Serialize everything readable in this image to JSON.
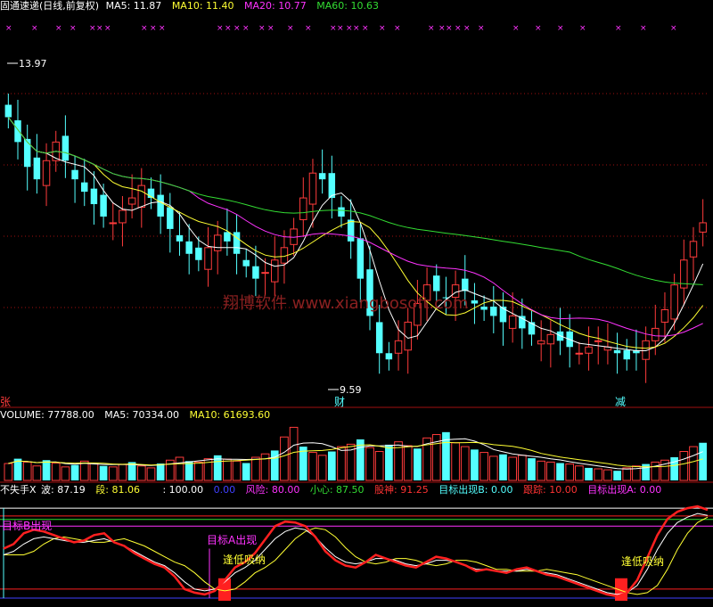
{
  "panels": {
    "price": {
      "title": "固通速递(日线,前复权)",
      "ma5_label": "MA5: 11.87",
      "ma10_label": "MA10: 11.40",
      "ma20_label": "MA20: 10.77",
      "ma60_label": "MA60: 10.63",
      "high_label": "13.97",
      "low_label": "9.59",
      "marker_cai": "财",
      "marker_jian": "减",
      "marker_zhang": "张",
      "watermark": "翔博软件 www.xiangbosoft.com"
    },
    "volume": {
      "title": "VOLUME: 77788.00",
      "ma5_label": "MA5: 70334.00",
      "ma10_label": "MA10: 61693.60"
    },
    "indicator": {
      "name": "不失手X",
      "bo": "波: 87.19",
      "duan": "段: 81.06",
      "v100": ": 100.00",
      "v0": "0.00",
      "fengxian": "风险: 80.00",
      "xiaoxin": "小心: 87.50",
      "gushen": "股神: 91.25",
      "mubiao_b": "目标出现B: 0.00",
      "genzong": "跟踪: 10.00",
      "mubiao_a": "目标出现A: 0.00",
      "ann_b": "目标B出现",
      "ann_a": "目标A出现",
      "ann_fengdi1": "逢低吸纳",
      "ann_fengdi2": "逢低吸纳"
    }
  },
  "colors": {
    "up": "#ff3b3b",
    "down": "#54ffff",
    "ma5": "#ffffff",
    "ma10": "#ffff33",
    "ma20": "#ff33ff",
    "ma60": "#33dd33",
    "grid": "#a01010",
    "ind_main": "#ff2020",
    "ind_fast": "#ffffff",
    "ind_slow": "#ffff33",
    "text_name": "#ffffff",
    "text_bo": "#ffffff",
    "text_duan": "#ffff33",
    "text_0": "#4040ff",
    "text_fx": "#ff33ff",
    "text_xx": "#33dd33",
    "text_gs": "#ff3333",
    "text_mb": "#54ffff",
    "text_gz": "#ff3333",
    "text_ma": "#ff33ff"
  },
  "chart_data": [
    {
      "type": "candlestick",
      "title": "固通速递(日线,前复权)",
      "ylim": [
        9.0,
        15.2
      ],
      "annotations": {
        "high": 13.97,
        "low": 9.59
      },
      "close_path": [
        13.6,
        13.2,
        12.8,
        12.6,
        12.9,
        13.2,
        12.9,
        12.6,
        12.4,
        12.2,
        12.0,
        11.9,
        12.1,
        12.3,
        12.5,
        12.3,
        12.0,
        11.8,
        11.6,
        11.4,
        11.3,
        11.5,
        11.7,
        11.6,
        11.4,
        11.2,
        11.0,
        11.1,
        11.3,
        11.5,
        11.8,
        12.3,
        12.7,
        12.6,
        12.3,
        12.0,
        11.6,
        11.0,
        10.4,
        9.8,
        9.7,
        10.0,
        10.3,
        10.6,
        10.9,
        10.8,
        10.7,
        10.9,
        10.8,
        10.6,
        10.5,
        10.4,
        10.3,
        10.4,
        10.2,
        10.1,
        10.0,
        10.1,
        10.0,
        9.9,
        9.8,
        9.9,
        10.0,
        9.9,
        9.8,
        9.7,
        9.8,
        10.0,
        10.2,
        10.5,
        10.9,
        11.3,
        11.6,
        11.9
      ]
    },
    {
      "type": "bar",
      "title": "VOLUME: 77788.00",
      "ylim": [
        0,
        120000
      ],
      "last_value": 77788.0,
      "ma5": 70334.0,
      "ma10": 61693.6,
      "values": [
        35,
        45,
        38,
        30,
        42,
        36,
        28,
        32,
        40,
        35,
        30,
        28,
        33,
        38,
        30,
        26,
        35,
        42,
        48,
        40,
        38,
        45,
        52,
        44,
        40,
        36,
        48,
        55,
        62,
        90,
        110,
        70,
        58,
        52,
        60,
        70,
        75,
        85,
        68,
        60,
        74,
        80,
        72,
        66,
        88,
        95,
        100,
        78,
        70,
        64,
        58,
        50,
        54,
        48,
        52,
        46,
        40,
        38,
        36,
        34,
        30,
        26,
        24,
        22,
        20,
        26,
        30,
        34,
        38,
        42,
        48,
        60,
        70,
        78
      ]
    },
    {
      "type": "line",
      "title": "不失手X",
      "ylim": [
        -5,
        110
      ],
      "series": [
        {
          "name": "波",
          "values": [
            55,
            60,
            72,
            76,
            74,
            70,
            66,
            62,
            64,
            70,
            72,
            62,
            58,
            50,
            44,
            38,
            34,
            24,
            10,
            6,
            4,
            8,
            20,
            34,
            40,
            50,
            65,
            80,
            85,
            84,
            80,
            68,
            52,
            42,
            36,
            34,
            40,
            48,
            44,
            40,
            36,
            34,
            40,
            46,
            44,
            40,
            36,
            30,
            32,
            30,
            28,
            32,
            34,
            30,
            26,
            24,
            20,
            16,
            12,
            8,
            4,
            2,
            6,
            20,
            45,
            70,
            88,
            96,
            100,
            102,
            98
          ]
        },
        {
          "name": "段",
          "values": [
            48,
            52,
            60,
            66,
            68,
            66,
            64,
            62,
            62,
            64,
            66,
            62,
            58,
            52,
            46,
            40,
            36,
            28,
            18,
            10,
            8,
            10,
            18,
            28,
            34,
            42,
            54,
            66,
            74,
            78,
            76,
            68,
            56,
            46,
            40,
            38,
            40,
            44,
            44,
            42,
            38,
            36,
            38,
            42,
            42,
            40,
            36,
            32,
            32,
            30,
            30,
            30,
            32,
            30,
            28,
            26,
            22,
            18,
            14,
            10,
            6,
            4,
            6,
            14,
            32,
            54,
            72,
            84,
            90,
            94,
            92
          ]
        }
      ]
    }
  ]
}
